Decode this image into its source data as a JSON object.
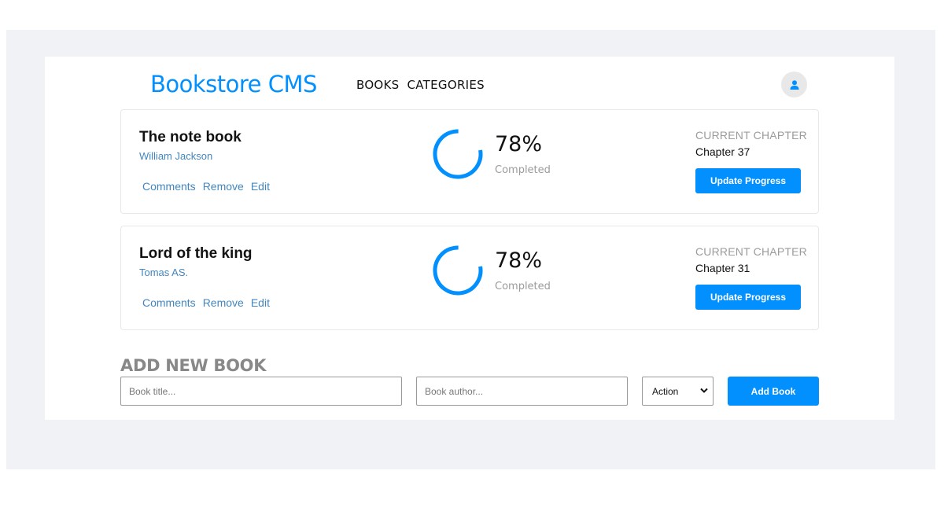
{
  "app": {
    "brand": "Bookstore CMS",
    "accent_color": "#0290ff",
    "nav": [
      {
        "label": "BOOKS"
      },
      {
        "label": "CATEGORIES"
      }
    ],
    "user_icon": "user-icon"
  },
  "books": [
    {
      "title": "The note book",
      "author": "William Jackson",
      "actions": [
        "Comments",
        "Remove",
        "Edit"
      ],
      "progress_percent": 78,
      "progress_label": "78%",
      "completed_label": "Completed",
      "current_chapter_label": "CURRENT CHAPTER",
      "current_chapter": "Chapter 37",
      "update_label": "Update Progress"
    },
    {
      "title": "Lord of the king",
      "author": "Tomas AS.",
      "actions": [
        "Comments",
        "Remove",
        "Edit"
      ],
      "progress_percent": 78,
      "progress_label": "78%",
      "completed_label": "Completed",
      "current_chapter_label": "CURRENT CHAPTER",
      "current_chapter": "Chapter 31",
      "update_label": "Update Progress"
    }
  ],
  "add_form": {
    "heading": "ADD NEW BOOK",
    "title_placeholder": "Book title...",
    "author_placeholder": "Book author...",
    "category_selected": "Action",
    "submit_label": "Add Book"
  }
}
